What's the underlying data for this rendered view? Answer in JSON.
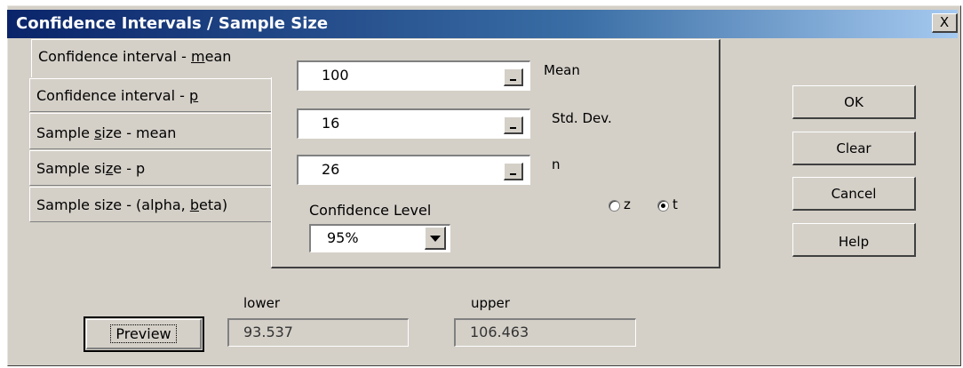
{
  "window": {
    "title": "Confidence Intervals / Sample Size",
    "close_label": "X"
  },
  "tabs": [
    {
      "pre": "Confidence interval - ",
      "u": "m",
      "post": "ean"
    },
    {
      "pre": "Confidence interval - ",
      "u": "p",
      "post": ""
    },
    {
      "pre": "Sample ",
      "u": "s",
      "post": "ize - mean"
    },
    {
      "pre": "Sample si",
      "u": "z",
      "post": "e - p"
    },
    {
      "pre": "Sample size - (alpha, ",
      "u": "b",
      "post": "eta)"
    }
  ],
  "fields": {
    "mean": {
      "value": "100",
      "label": "Mean"
    },
    "sd": {
      "value": "16",
      "label": "Std. Dev."
    },
    "n": {
      "value": "26",
      "label": "n"
    }
  },
  "confidence": {
    "label": "Confidence Level",
    "selected": "95%"
  },
  "distribution": {
    "options": [
      "z",
      "t"
    ],
    "selected": "t"
  },
  "buttons": {
    "ok": "OK",
    "clear": "Clear",
    "cancel": "Cancel",
    "help": "Help",
    "preview": "Preview"
  },
  "results": {
    "lower_label": "lower",
    "lower_value": "93.537",
    "upper_label": "upper",
    "upper_value": "106.463"
  }
}
